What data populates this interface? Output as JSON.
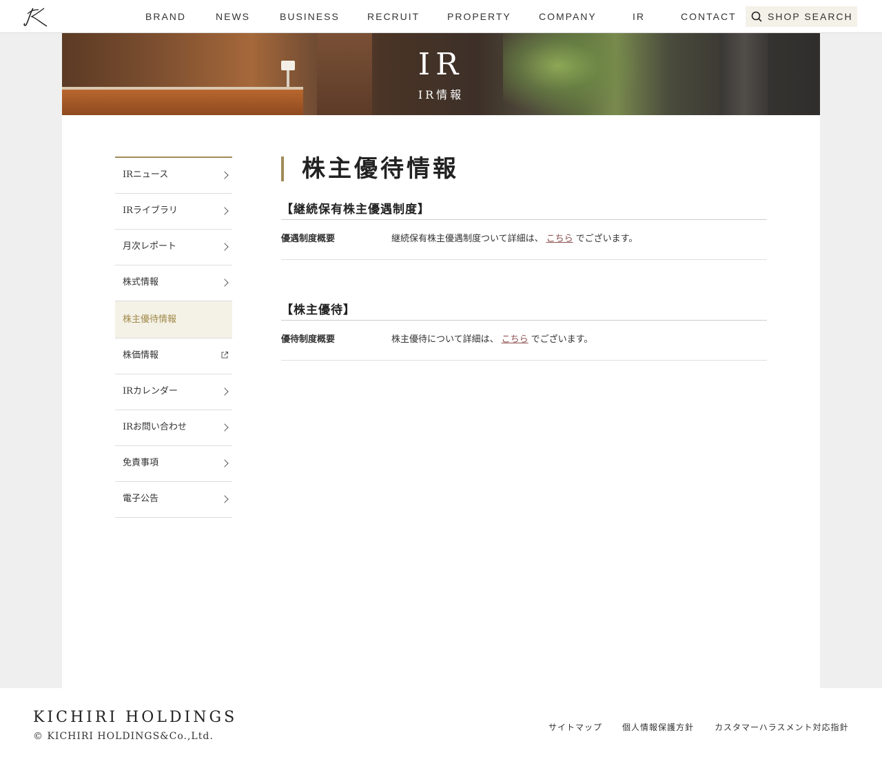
{
  "header": {
    "logo_icon": "kichiri-k-logo",
    "nav": [
      "BRAND",
      "NEWS",
      "BUSINESS",
      "RECRUIT",
      "PROPERTY",
      "COMPANY",
      "IR",
      "CONTACT"
    ],
    "shop_search_label": "SHOP SEARCH",
    "shop_search_icon": "search-icon"
  },
  "hero": {
    "title": "IR",
    "subtitle": "IR情報"
  },
  "sidebar": {
    "items": [
      {
        "label": "IRニュース",
        "icon": "chevron-right-icon"
      },
      {
        "label": "IRライブラリ",
        "icon": "chevron-right-icon"
      },
      {
        "label": "月次レポート",
        "icon": "chevron-right-icon"
      },
      {
        "label": "株式情報",
        "icon": "chevron-right-icon"
      },
      {
        "label": "株主優待情報",
        "icon": "",
        "active": true
      },
      {
        "label": "株価情報",
        "icon": "external-link-icon"
      },
      {
        "label": "IRカレンダー",
        "icon": "chevron-right-icon"
      },
      {
        "label": "IRお問い合わせ",
        "icon": "chevron-right-icon"
      },
      {
        "label": "免責事項",
        "icon": "chevron-right-icon"
      },
      {
        "label": "電子公告",
        "icon": "chevron-right-icon"
      }
    ],
    "accent_color": "#a08a5a"
  },
  "content": {
    "page_title": "株主優待情報",
    "sections": [
      {
        "heading": "【継続保有株主優遇制度】",
        "label": "優遇制度概要",
        "text_before": "継続保有株主優遇制度ついて詳細は、",
        "link": "こちら",
        "text_after": "でございます。"
      },
      {
        "heading": "【株主優待】",
        "label": "優待制度概要",
        "text_before": "株主優待について詳細は、",
        "link": "こちら",
        "text_after": "でございます。"
      }
    ]
  },
  "footer": {
    "brand": "KICHIRI HOLDINGS",
    "copyright": "© KICHIRI HOLDINGS&Co.,Ltd.",
    "links": [
      "サイトマップ",
      "個人情報保護方針",
      "カスタマーハラスメント対応指針"
    ]
  }
}
